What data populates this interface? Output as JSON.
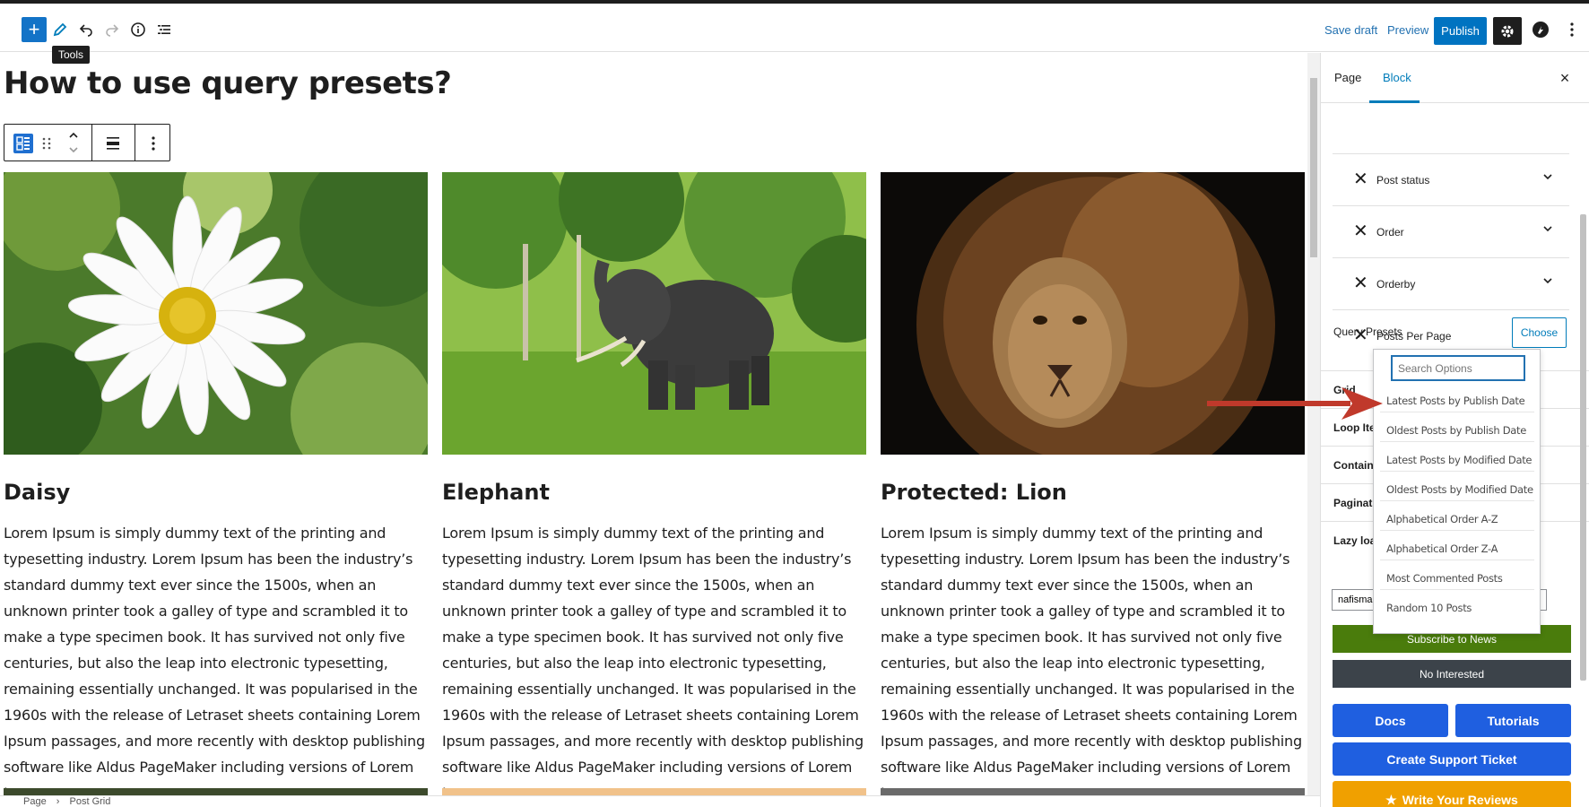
{
  "toolbar": {
    "add_label": "+",
    "tooltip": "Tools",
    "save_draft": "Save draft",
    "preview": "Preview",
    "publish": "Publish"
  },
  "page": {
    "title": "How to use query presets?"
  },
  "posts": [
    {
      "title": "Daisy",
      "text": "Lorem Ipsum is simply dummy text of the printing and typesetting industry. Lorem Ipsum has been the industry’s standard dummy text ever since the 1500s, when an unknown printer took a galley of type and scrambled it to make a type specimen book. It has survived not only five centuries, but also the leap into electronic typesetting, remaining essentially unchanged. It was popularised in the 1960s with the release of Letraset sheets containing Lorem Ipsum passages, and more recently with desktop publishing software like Aldus PageMaker including versions of Lorem Ipsum."
    },
    {
      "title": "Elephant",
      "text": "Lorem Ipsum is simply dummy text of the printing and typesetting industry. Lorem Ipsum has been the industry’s standard dummy text ever since the 1500s, when an unknown printer took a galley of type and scrambled it to make a type specimen book. It has survived not only five centuries, but also the leap into electronic typesetting, remaining essentially unchanged. It was popularised in the 1960s with the release of Letraset sheets containing Lorem Ipsum passages, and more recently with desktop publishing software like Aldus PageMaker including versions of Lorem Ipsum."
    },
    {
      "title": "Protected: Lion",
      "text": "Lorem Ipsum is simply dummy text of the printing and typesetting industry. Lorem Ipsum has been the industry’s standard dummy text ever since the 1500s, when an unknown printer took a galley of type and scrambled it to make a type specimen book. It has survived not only five centuries, but also the leap into electronic typesetting, remaining essentially unchanged. It was popularised in the 1960s with the release of Letraset sheets containing Lorem Ipsum passages, and more recently with desktop publishing software like Aldus PageMaker including versions of Lorem Ipsum."
    }
  ],
  "breadcrumb": {
    "page": "Page",
    "separator": "›",
    "block": "Post Grid"
  },
  "sidebar": {
    "tab_page": "Page",
    "tab_block": "Block",
    "close": "×",
    "filters": [
      "Post status",
      "Order",
      "Orderby",
      "Posts Per Page"
    ],
    "query_presets_label": "Query Presets",
    "choose": "Choose",
    "panels": [
      "Grid",
      "Loop Ite",
      "Containe",
      "Paginati",
      "Lazy loa"
    ],
    "email_value": "nafisma",
    "subscribe": "Subscribe to News",
    "no_interested": "No Interested",
    "docs": "Docs",
    "tutorials": "Tutorials",
    "support": "Create Support Ticket",
    "review": "Write Your Reviews"
  },
  "dropdown": {
    "search_placeholder": "Search Options",
    "options": [
      "Latest Posts by Publish Date",
      "Oldest Posts by Publish Date",
      "Latest Posts by Modified Date",
      "Oldest Posts by Modified Date",
      "Alphabetical Order A-Z",
      "Alphabetical Order Z-A",
      "Most Commented Posts",
      "Random 10 Posts"
    ]
  },
  "colors": {
    "accent": "#007cba",
    "publish": "#0073c1",
    "arrow": "#c0392b",
    "subscribe": "#4a7c0c",
    "button_blue": "#1f5fe0",
    "review": "#f0a000"
  }
}
